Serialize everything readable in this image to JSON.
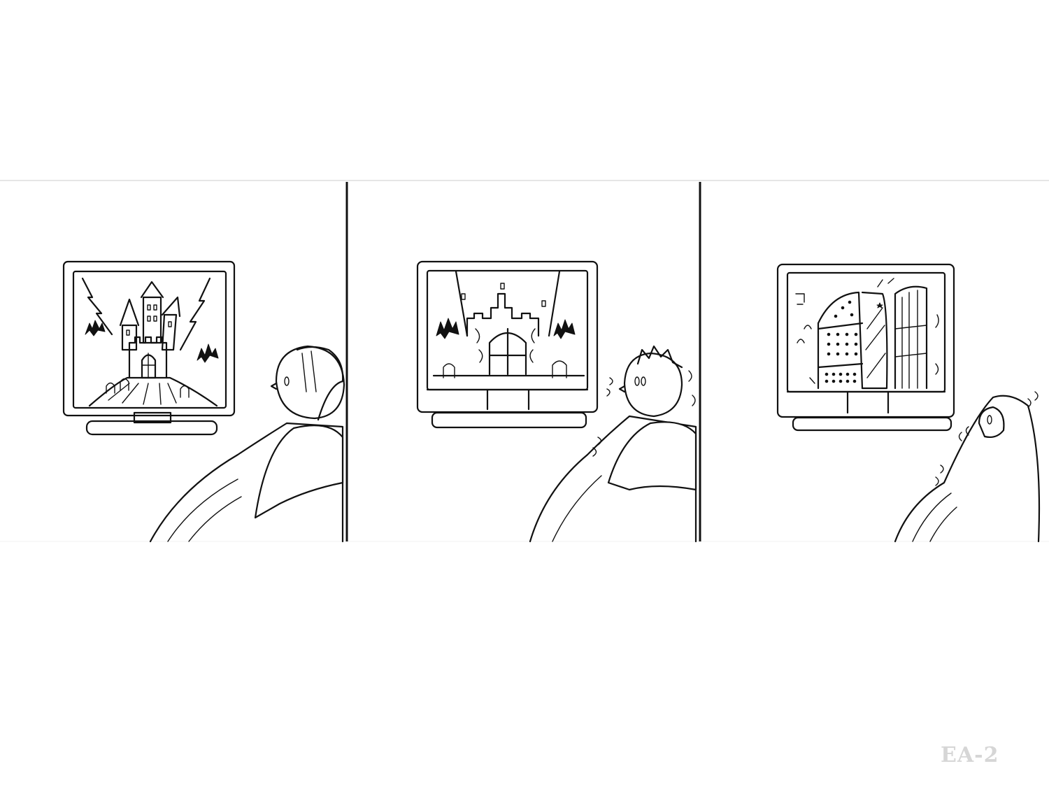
{
  "comic": {
    "panels": [
      {
        "name": "panel-1",
        "tv_scene": "castle-on-hill",
        "viewer": "calm"
      },
      {
        "name": "panel-2",
        "tv_scene": "castle-gate",
        "viewer": "shivering"
      },
      {
        "name": "panel-3",
        "tv_scene": "door-opening",
        "viewer": "hiding-under-blanket"
      }
    ],
    "label": "EA-2",
    "colors": {
      "ink": "#111111",
      "paper": "#ffffff",
      "label": "#d6d6d6",
      "strip_edge": "#e6e6e6"
    }
  }
}
